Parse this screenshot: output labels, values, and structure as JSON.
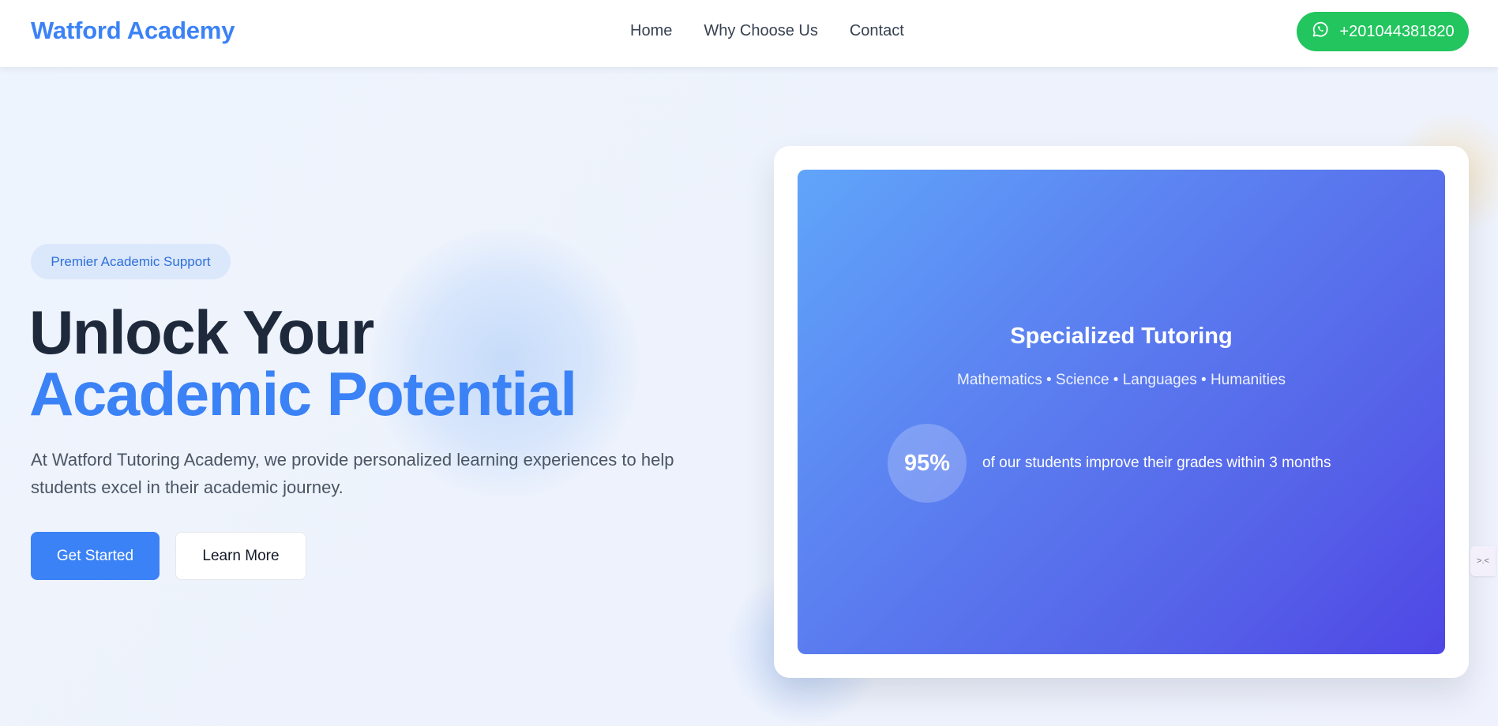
{
  "header": {
    "brand": "Watford Academy",
    "nav": [
      "Home",
      "Why Choose Us",
      "Contact"
    ],
    "whatsapp_number": "+201044381820",
    "whatsapp_icon": "whatsapp-icon"
  },
  "hero": {
    "badge": "Premier Academic Support",
    "headline_line1": "Unlock Your",
    "headline_line2": "Academic Potential",
    "lead": "At Watford Tutoring Academy, we provide personalized learning experiences to help students excel in their academic journey.",
    "primary_button": "Get Started",
    "secondary_button": "Learn More"
  },
  "card": {
    "title": "Specialized Tutoring",
    "subjects": "Mathematics • Science • Languages • Humanities",
    "stat_value": "95%",
    "stat_text": "of our students improve their grades within 3 months"
  },
  "edge_widget": {
    "label": ">.<"
  },
  "colors": {
    "accent": "#3b82f6",
    "whatsapp": "#22c55e",
    "heading": "#1e293b",
    "card_gradient_start": "#60a5fa",
    "card_gradient_end": "#4f46e5"
  }
}
